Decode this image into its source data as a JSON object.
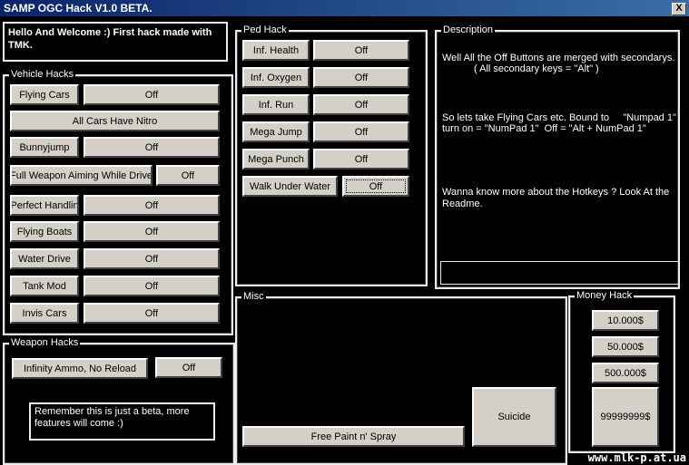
{
  "window": {
    "title": "SAMP OGC Hack V1.0 BETA.",
    "close_label": "X"
  },
  "welcome": {
    "text": "Hello And Welcome :) First hack made with TMK."
  },
  "vehicle": {
    "title": "Vehicle Hacks",
    "flying_cars": "Flying Cars",
    "flying_cars_off": "Off",
    "all_cars_nitro": "All Cars Have Nitro",
    "bunnyjump": "Bunnyjump",
    "bunnyjump_off": "Off",
    "full_weapon": "Full Weapon Aiming While Drive",
    "full_weapon_off": "Off",
    "perfect_handling": "Perfect Handlin",
    "perfect_handling_off": "Off",
    "flying_boats": "Flying Boats",
    "flying_boats_off": "Off",
    "water_drive": "Water Drive",
    "water_drive_off": "Off",
    "tank_mod": "Tank Mod",
    "tank_mod_off": "Off",
    "invis_cars": "Invis Cars",
    "invis_cars_off": "Off"
  },
  "weapon": {
    "title": "Weapon Hacks",
    "infinity_ammo": "Infinity Ammo, No Reload",
    "infinity_ammo_off": "Off",
    "note": "Remember this is just a beta, more features will come :)"
  },
  "ped": {
    "title": "Ped Hack",
    "inf_health": "Inf. Health",
    "inf_health_off": "Off",
    "inf_oxygen": "Inf. Oxygen",
    "inf_oxygen_off": "Off",
    "inf_run": "Inf. Run",
    "inf_run_off": "Off",
    "mega_jump": "Mega Jump",
    "mega_jump_off": "Off",
    "mega_punch": "Mega Punch",
    "mega_punch_off": "Off",
    "walk_under_water": "Walk Under Water",
    "walk_under_water_off": "Off"
  },
  "description": {
    "title": "Description",
    "line1": "Well All the Off Buttons are merged with secondarys.",
    "line2": "( All secondary keys = \"Alt\" )",
    "line3": "So lets take Flying Cars etc. Bound to     \"Numpad 1\"",
    "line4": "turn on = \"NumPad 1\"  Off = \"Alt + NumPad 1\"",
    "line5": "Wanna know more about the Hotkeys ? Look At the Readme."
  },
  "misc": {
    "title": "Misc",
    "free_paint": "Free Paint n' Spray",
    "suicide": "Suicide"
  },
  "money": {
    "title": "Money Hack",
    "m10000": "10.000$",
    "m50000": "50.000$",
    "m500000": "500.000$",
    "mmax": "99999999$"
  },
  "watermark": "www.mlk-p.at.ua"
}
